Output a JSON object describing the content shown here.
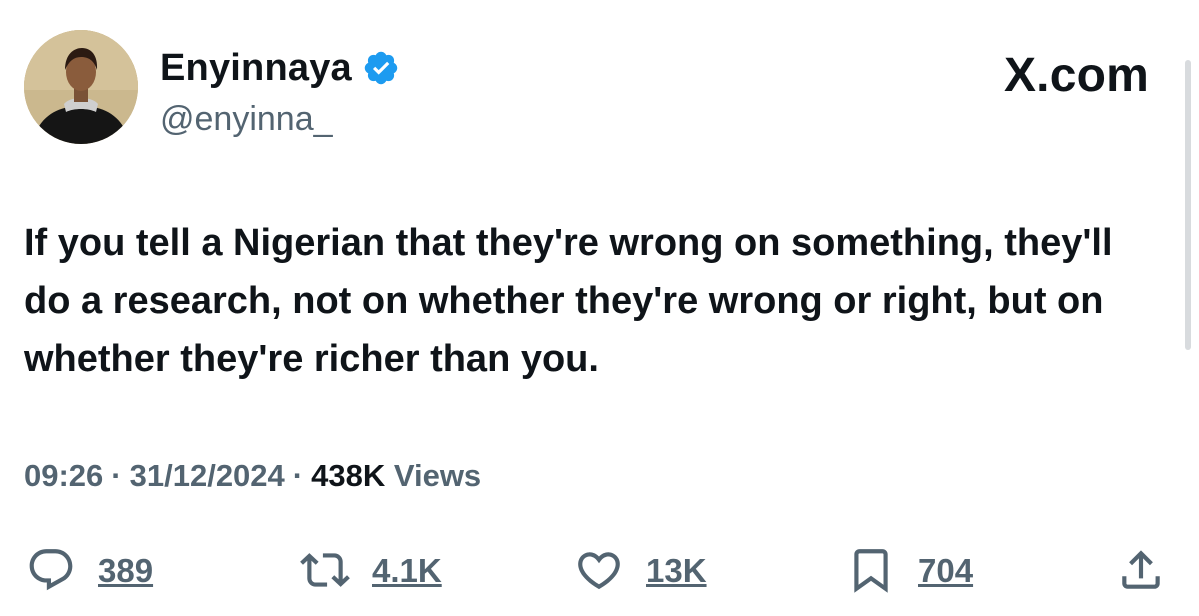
{
  "author": {
    "display_name": "Enyinnaya",
    "handle": "@enyinna_",
    "verified_icon": "verified-badge-icon"
  },
  "brand": {
    "label": "X.com"
  },
  "tweet": {
    "text": "If you tell a Nigerian that they're wrong on something, they'll do a research, not on whether they're wrong or right, but on whether they're richer than you."
  },
  "meta": {
    "time": "09:26",
    "date": "31/12/2024",
    "views_count": "438K",
    "views_label": "Views",
    "separator": "·"
  },
  "actions": {
    "reply": {
      "icon": "reply-icon",
      "count": "389"
    },
    "repost": {
      "icon": "repost-icon",
      "count": "4.1K"
    },
    "like": {
      "icon": "heart-icon",
      "count": "13K"
    },
    "bookmark": {
      "icon": "bookmark-icon",
      "count": "704"
    },
    "share": {
      "icon": "share-icon"
    }
  },
  "colors": {
    "text_primary": "#0f1419",
    "text_secondary": "#536471",
    "verified_blue": "#1d9bf0",
    "background": "#ffffff"
  }
}
